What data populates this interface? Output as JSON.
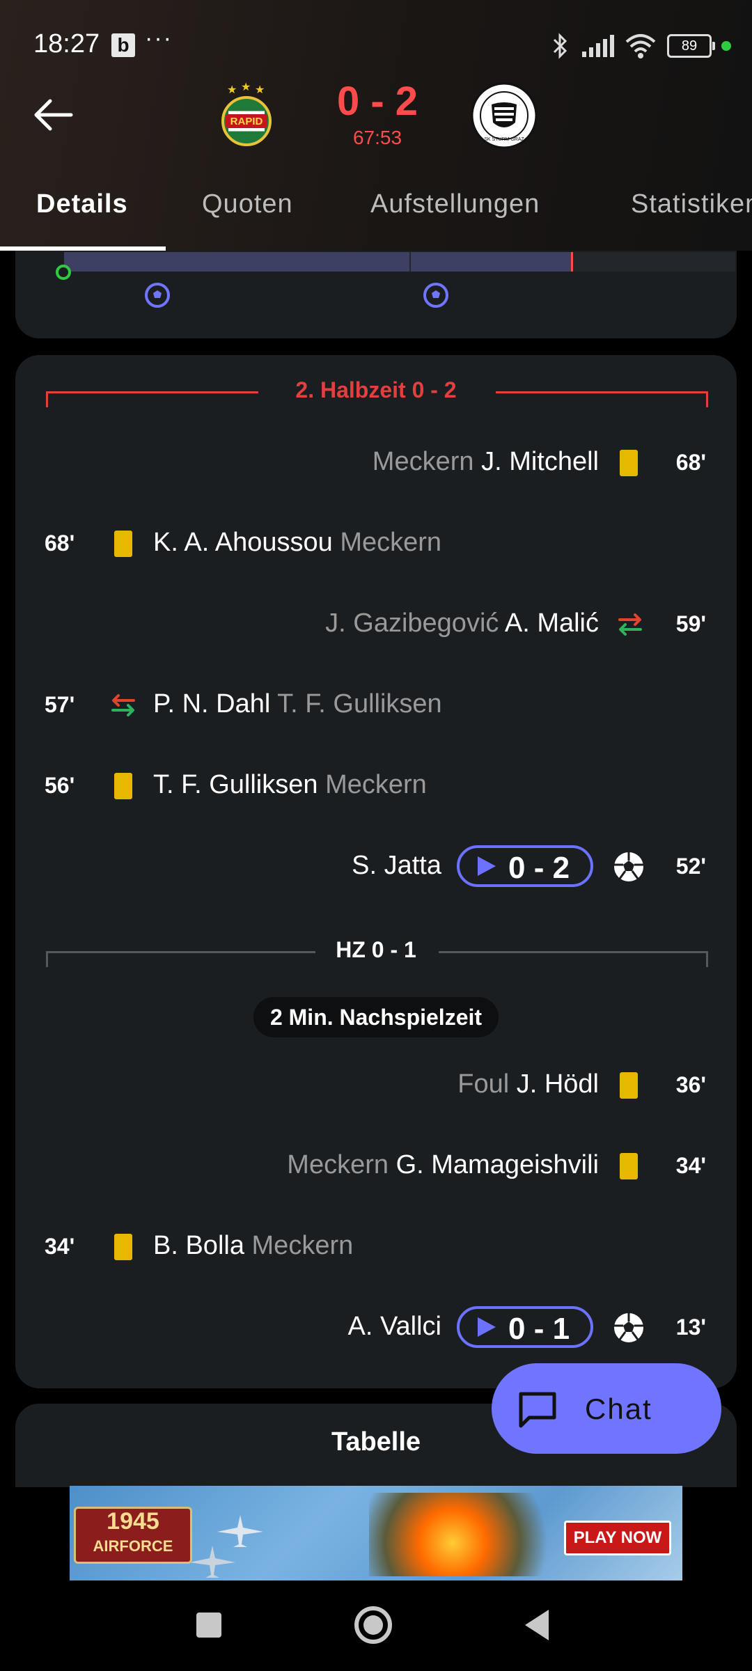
{
  "status_bar": {
    "time": "18:27",
    "notification_icon": "b",
    "more": "···",
    "battery": "89",
    "icons": [
      "bluetooth-icon",
      "signal-icon",
      "wifi-icon",
      "battery-icon"
    ]
  },
  "match": {
    "score": "0 - 2",
    "minute": "67:53",
    "home_crest_text": "RAPID",
    "away_crest_text": "SK STURM GRAZ"
  },
  "tabs": [
    {
      "label": "Details",
      "active": true
    },
    {
      "label": "Quoten",
      "active": false
    },
    {
      "label": "Aufstellungen",
      "active": false
    },
    {
      "label": "Statistiken",
      "active": false
    }
  ],
  "timeline": {
    "progress_fraction": 0.77,
    "goals_at_minutes": [
      13,
      52
    ]
  },
  "second_half": {
    "title": "2. Halbzeit 0 - 2",
    "events": [
      {
        "minute": "68'",
        "side": "away",
        "type": "yellow-card",
        "player": "J. Mitchell",
        "detail": "Meckern"
      },
      {
        "minute": "68'",
        "side": "home",
        "type": "yellow-card",
        "player": "K. A. Ahoussou",
        "detail": "Meckern"
      },
      {
        "minute": "59'",
        "side": "away",
        "type": "substitution",
        "player": "A. Malić",
        "detail": "J. Gazibegović"
      },
      {
        "minute": "57'",
        "side": "home",
        "type": "substitution",
        "player": "P. N. Dahl",
        "detail": "T. F. Gulliksen"
      },
      {
        "minute": "56'",
        "side": "home",
        "type": "yellow-card",
        "player": "T. F. Gulliksen",
        "detail": "Meckern"
      },
      {
        "minute": "52'",
        "side": "away",
        "type": "goal",
        "player": "S. Jatta",
        "score": "0 - 2"
      }
    ]
  },
  "first_half": {
    "title": "HZ 0 - 1",
    "stoppage": "2 Min. Nachspielzeit",
    "events": [
      {
        "minute": "36'",
        "side": "away",
        "type": "yellow-card",
        "player": "J. Hödl",
        "detail": "Foul"
      },
      {
        "minute": "34'",
        "side": "away",
        "type": "yellow-card",
        "player": "G. Mamageishvili",
        "detail": "Meckern"
      },
      {
        "minute": "34'",
        "side": "home",
        "type": "yellow-card",
        "player": "B. Bolla",
        "detail": "Meckern"
      },
      {
        "minute": "13'",
        "side": "away",
        "type": "goal",
        "player": "A. Vallci",
        "score": "0 - 1"
      }
    ]
  },
  "table_section": {
    "title": "Tabelle"
  },
  "chat": {
    "label": "Chat"
  },
  "ad": {
    "logo_line1": "1945",
    "logo_line2": "AIRFORCE",
    "cta": "PLAY NOW"
  },
  "colors": {
    "accent": "#6b72ff",
    "score_red": "#ff4b4b",
    "card_yellow": "#e6b800",
    "card_bg": "#1b1e21",
    "sub_green": "#2eb35c",
    "sub_red": "#e0442e"
  }
}
